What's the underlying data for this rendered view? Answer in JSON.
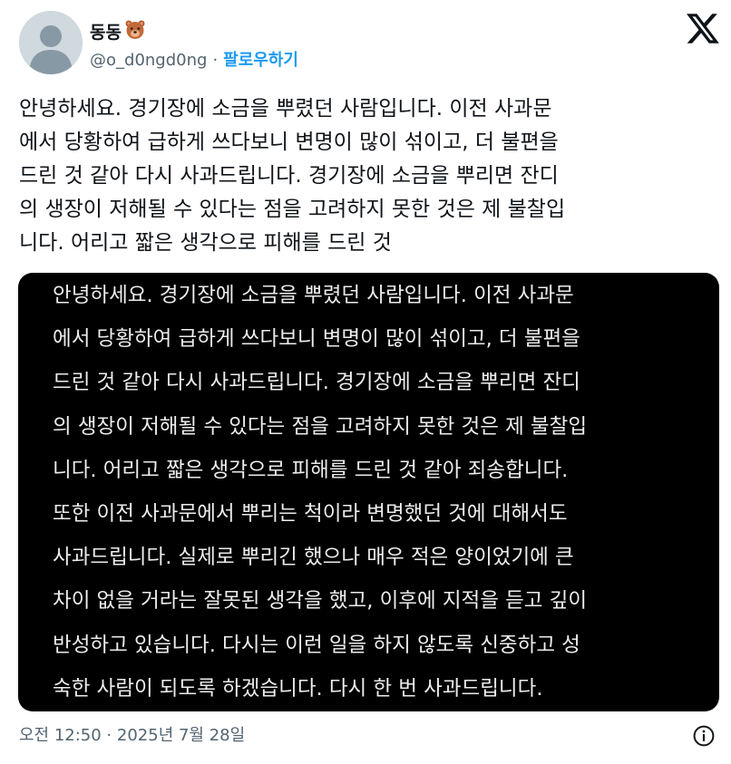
{
  "author": {
    "display_name": "동동",
    "name_emoji": "bear-face-icon",
    "handle": "@o_d0ngd0ng",
    "separator": "·",
    "follow_label": "팔로우하기",
    "avatar_icon": "default-avatar-icon"
  },
  "header": {
    "platform_icon": "x-logo-icon"
  },
  "tweet": {
    "text": "안녕하세요. 경기장에 소금을 뿌렸던 사람입니다. 이전 사과문\n에서 당황하여 급하게 쓰다보니 변명이 많이 섞이고, 더 불편을\n드린 것 같아 다시 사과드립니다. 경기장에 소금을 뿌리면 잔디\n의 생장이 저해될 수 있다는 점을 고려하지 못한 것은 제 불찰입\n니다. 어리고 짧은 생각으로 피해를 드린 것"
  },
  "media": {
    "text": "안녕하세요. 경기장에 소금을 뿌렸던 사람입니다. 이전 사과문\n에서 당황하여 급하게 쓰다보니 변명이 많이 섞이고, 더 불편을\n드린 것 같아 다시 사과드립니다. 경기장에 소금을 뿌리면 잔디\n의 생장이 저해될 수 있다는 점을 고려하지 못한 것은 제 불찰입\n니다. 어리고 짧은 생각으로 피해를 드린 것 같아 죄송합니다.\n또한 이전 사과문에서 뿌리는 척이라 변명했던 것에 대해서도\n사과드립니다. 실제로 뿌리긴 했으나 매우 적은 양이었기에 큰\n차이 없을 거라는 잘못된 생각을 했고, 이후에 지적을 듣고 깊이\n반성하고 있습니다. 다시는 이런 일을 하지 않도록 신중하고 성\n숙한 사람이 되도록 하겠습니다. 다시 한 번 사과드립니다."
  },
  "footer": {
    "timestamp": "오전 12:50 · 2025년 7월 28일",
    "info_icon": "info-icon"
  },
  "colors": {
    "accent": "#1d9bf0",
    "secondary_text": "#536471",
    "primary_text": "#0f1419",
    "media_background": "#000000"
  }
}
